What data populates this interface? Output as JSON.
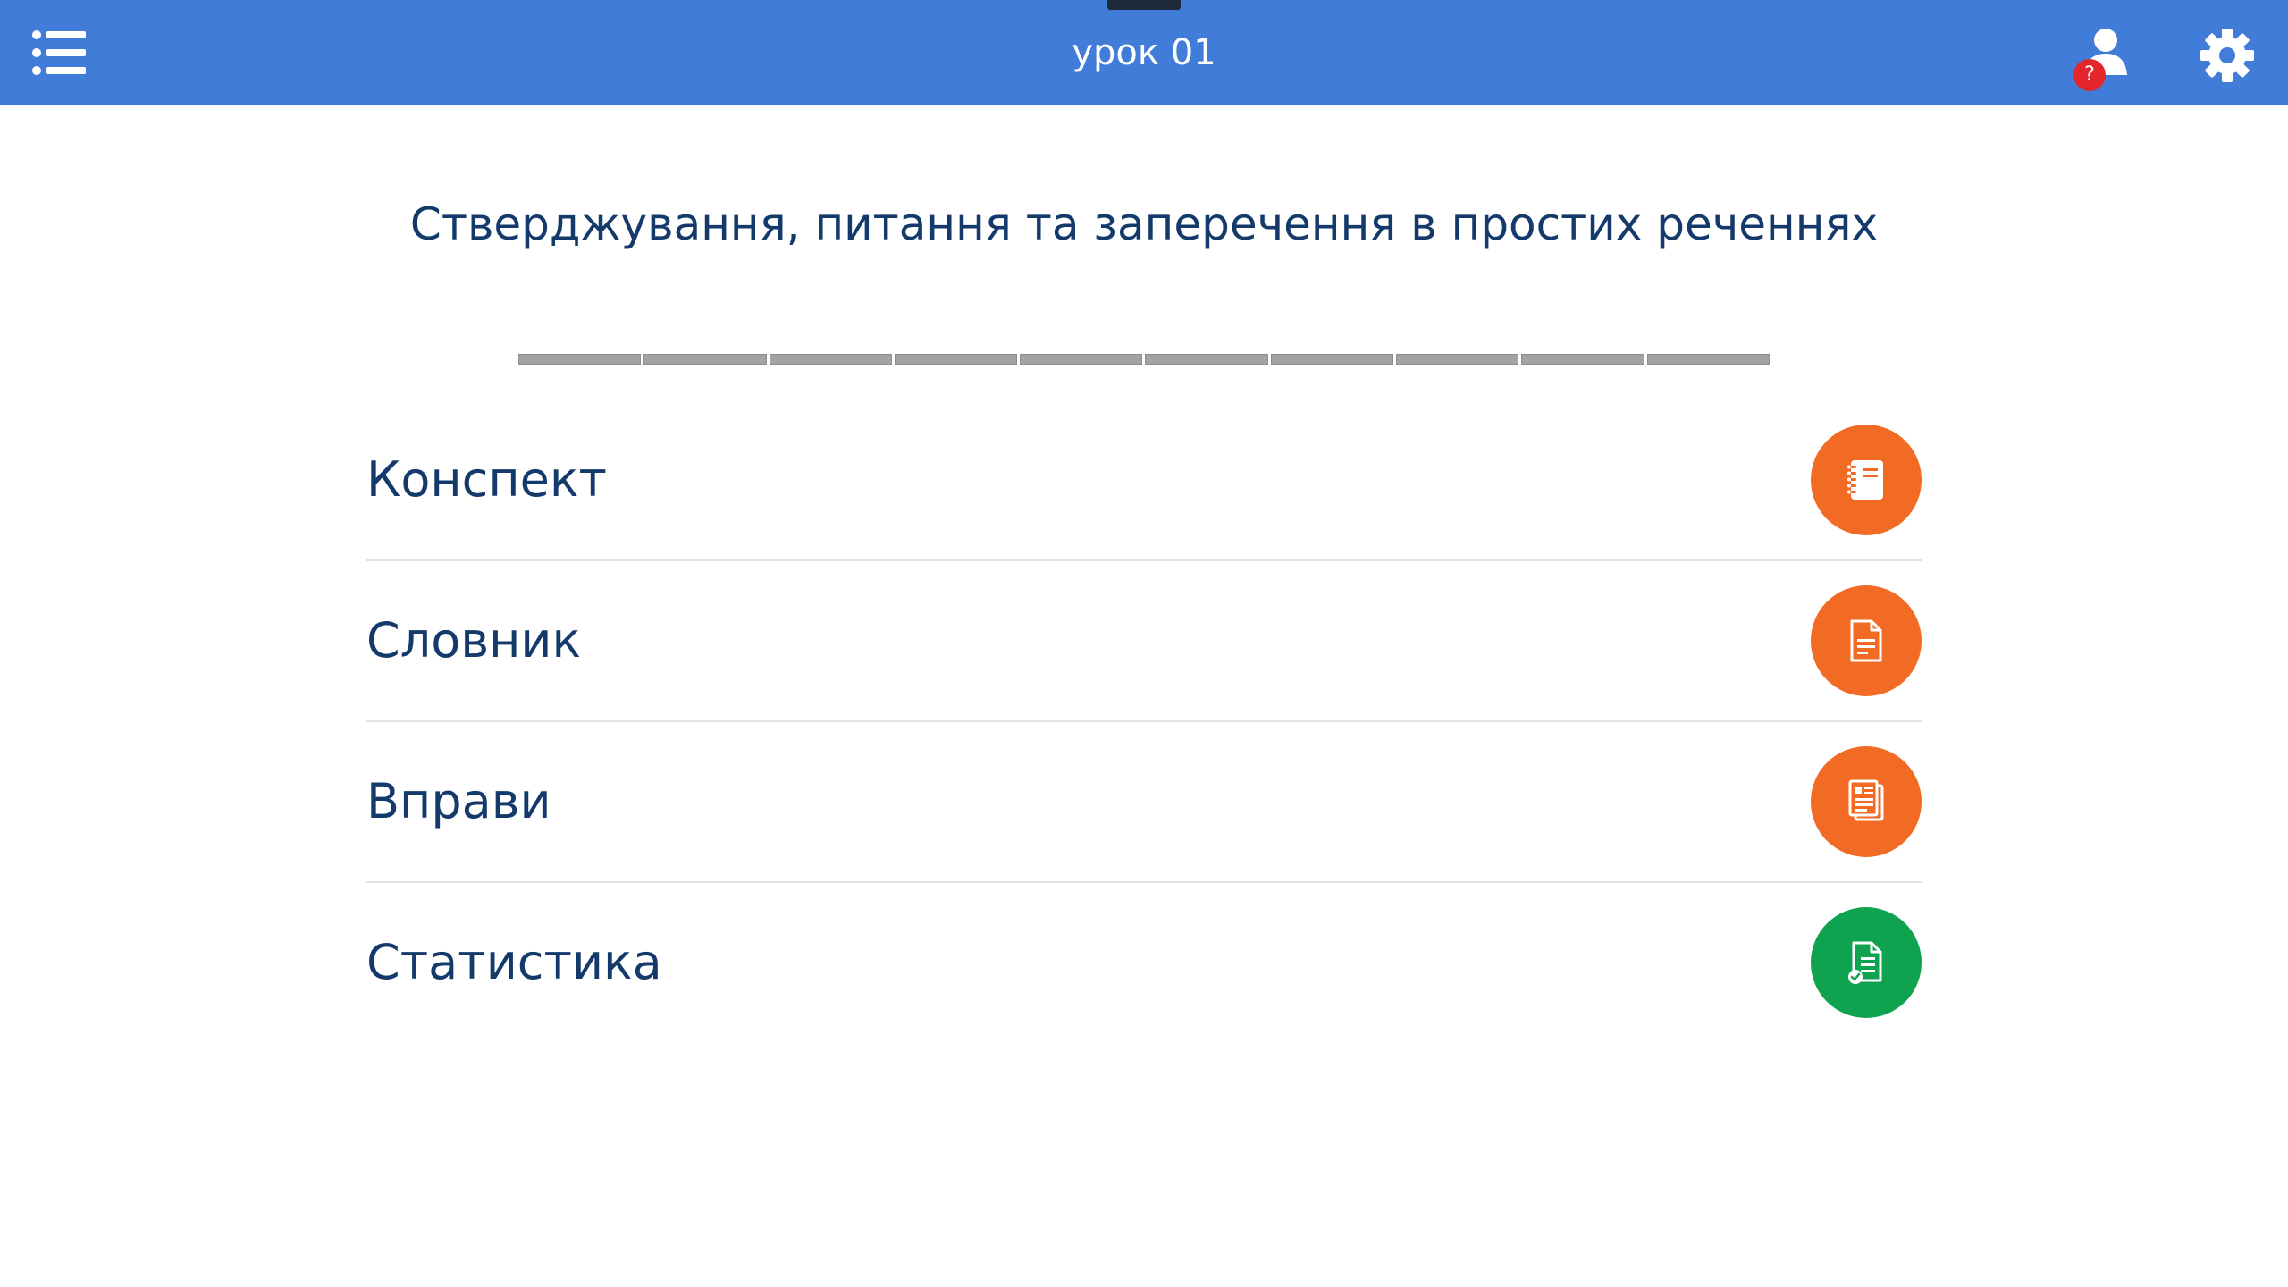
{
  "header": {
    "title": "урок 01",
    "menu_icon": "list-icon",
    "user_icon": "user-icon",
    "user_badge": "?",
    "settings_icon": "gear-icon"
  },
  "lesson": {
    "title": "Стверджування, питання та заперечення в простих реченнях"
  },
  "progress": {
    "segments": 10,
    "completed": 0
  },
  "menu": {
    "items": [
      {
        "label": "Конспект",
        "icon": "notebook-icon",
        "color": "#f26b24"
      },
      {
        "label": "Словник",
        "icon": "document-icon",
        "color": "#f26b24"
      },
      {
        "label": "Вправи",
        "icon": "documents-stack-icon",
        "color": "#f26b24"
      },
      {
        "label": "Статистика",
        "icon": "document-check-icon",
        "color": "#0fa34f"
      }
    ]
  },
  "colors": {
    "header": "#417cd9",
    "title_text": "#133a6b",
    "badge": "#e3262b",
    "progress_track": "#a3a3a3"
  }
}
